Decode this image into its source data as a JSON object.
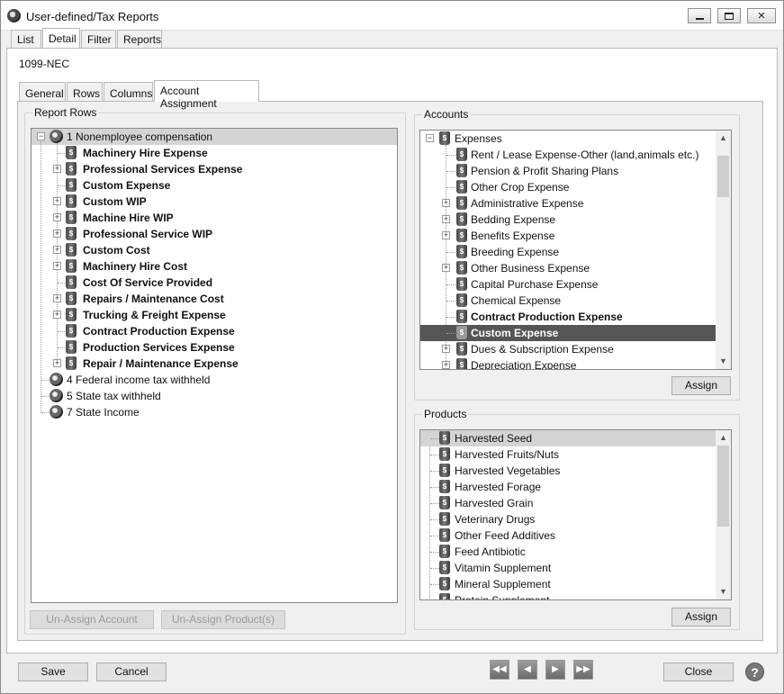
{
  "window": {
    "title": "User-defined/Tax Reports"
  },
  "tabs": [
    {
      "label": "List",
      "active": false
    },
    {
      "label": "Detail",
      "active": true
    },
    {
      "label": "Filter",
      "active": false
    },
    {
      "label": "Reports",
      "active": false
    }
  ],
  "record_name": "1099-NEC",
  "sub_tabs": [
    {
      "label": "General",
      "active": false
    },
    {
      "label": "Rows",
      "active": false
    },
    {
      "label": "Columns",
      "active": false
    },
    {
      "label": "Account Assignment",
      "active": true
    }
  ],
  "report_rows": {
    "title": "Report Rows",
    "root": "1 Nonemployee compensation",
    "children": [
      {
        "label": "Machinery Hire Expense",
        "expandable": false
      },
      {
        "label": "Professional Services Expense",
        "expandable": true
      },
      {
        "label": "Custom Expense",
        "expandable": false
      },
      {
        "label": "Custom WIP",
        "expandable": true
      },
      {
        "label": "Machine Hire WIP",
        "expandable": true
      },
      {
        "label": "Professional Service WIP",
        "expandable": true
      },
      {
        "label": "Custom Cost",
        "expandable": true
      },
      {
        "label": "Machinery Hire Cost",
        "expandable": true
      },
      {
        "label": "Cost Of Service Provided",
        "expandable": false
      },
      {
        "label": "Repairs / Maintenance Cost",
        "expandable": true
      },
      {
        "label": "Trucking & Freight Expense",
        "expandable": true
      },
      {
        "label": "Contract Production Expense",
        "expandable": false
      },
      {
        "label": "Production Services Expense",
        "expandable": false
      },
      {
        "label": "Repair / Maintenance Expense",
        "expandable": true
      }
    ],
    "other_roots": [
      "4 Federal income tax withheld",
      "5 State tax withheld",
      "7 State Income"
    ]
  },
  "accounts": {
    "title": "Accounts",
    "root": "Expenses",
    "items": [
      {
        "label": "Rent / Lease Expense-Other (land,animals etc.)",
        "expandable": false,
        "bold": false,
        "selected": false
      },
      {
        "label": "Pension & Profit Sharing Plans",
        "expandable": false,
        "bold": false,
        "selected": false
      },
      {
        "label": "Other Crop Expense",
        "expandable": false,
        "bold": false,
        "selected": false
      },
      {
        "label": "Administrative Expense",
        "expandable": true,
        "bold": false,
        "selected": false
      },
      {
        "label": "Bedding Expense",
        "expandable": true,
        "bold": false,
        "selected": false
      },
      {
        "label": "Benefits Expense",
        "expandable": true,
        "bold": false,
        "selected": false
      },
      {
        "label": "Breeding Expense",
        "expandable": false,
        "bold": false,
        "selected": false
      },
      {
        "label": "Other Business Expense",
        "expandable": true,
        "bold": false,
        "selected": false
      },
      {
        "label": "Capital Purchase Expense",
        "expandable": false,
        "bold": false,
        "selected": false
      },
      {
        "label": "Chemical Expense",
        "expandable": false,
        "bold": false,
        "selected": false
      },
      {
        "label": "Contract Production Expense",
        "expandable": false,
        "bold": true,
        "selected": false
      },
      {
        "label": "Custom Expense",
        "expandable": false,
        "bold": true,
        "selected": true
      },
      {
        "label": "Dues & Subscription Expense",
        "expandable": true,
        "bold": false,
        "selected": false
      },
      {
        "label": "Depreciation Expense",
        "expandable": true,
        "bold": false,
        "selected": false
      }
    ],
    "assign_label": "Assign"
  },
  "products": {
    "title": "Products",
    "items": [
      "Harvested Seed",
      "Harvested Fruits/Nuts",
      "Harvested Vegetables",
      "Harvested Forage",
      "Harvested Grain",
      "Veterinary Drugs",
      "Other Feed Additives",
      "Feed Antibiotic",
      "Vitamin Supplement",
      "Mineral Supplement",
      "Protein Supplement"
    ],
    "highlighted": "Harvested Seed",
    "assign_label": "Assign"
  },
  "buttons": {
    "unassign_account": "Un-Assign Account",
    "unassign_products": "Un-Assign Product(s)",
    "save": "Save",
    "cancel": "Cancel",
    "close": "Close",
    "help": "?"
  },
  "icons": {
    "account": "ledger-icon",
    "report_row": "row-circle-icon",
    "first": "first-record-icon",
    "prev": "previous-record-icon",
    "next": "next-record-icon",
    "last": "last-record-icon"
  }
}
